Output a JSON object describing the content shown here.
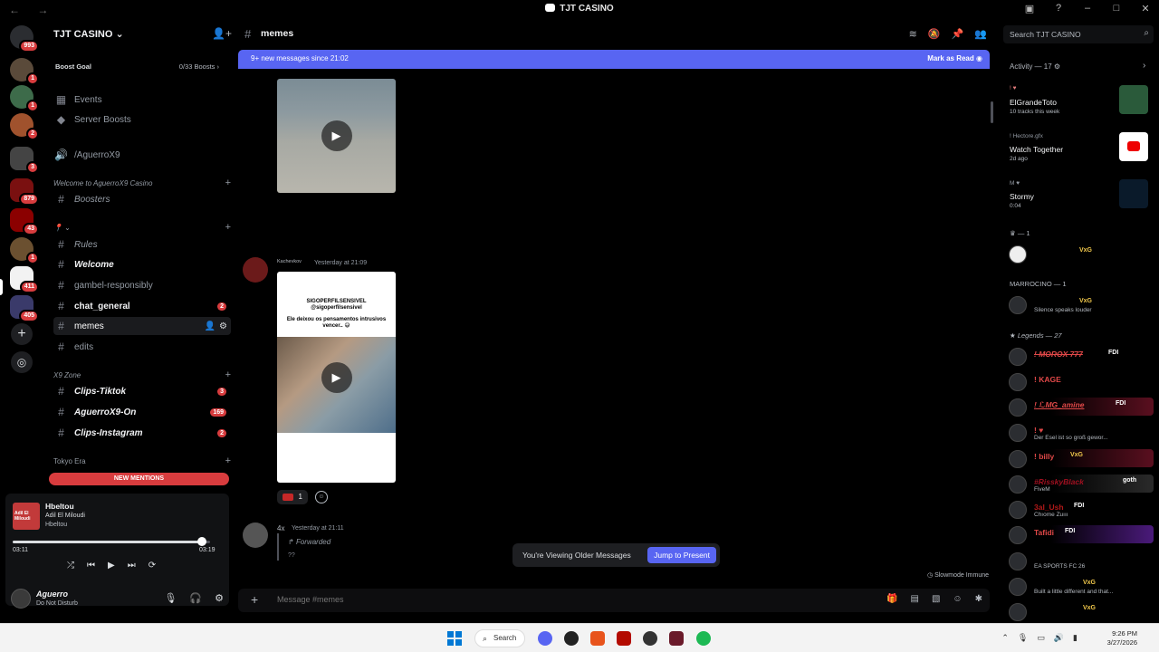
{
  "window": {
    "title": "TJT CASINO",
    "nav_arrows": "← →",
    "controls": [
      "▣",
      "?",
      "–",
      "□",
      "✕"
    ]
  },
  "server_rail": {
    "badges": [
      "993",
      "1",
      "1",
      "2",
      "3",
      "879",
      "43",
      "1",
      "411",
      "405"
    ],
    "add_label": "+",
    "discover_label": "◎"
  },
  "sidebar": {
    "server_name": "TJT CASINO",
    "boost_goal_label": "Boost Goal",
    "boost_count": "0/33 Boosts",
    "items": [
      {
        "label": "Events",
        "icon": "calendar-icon"
      },
      {
        "label": "Server Boosts",
        "icon": "boost-icon"
      },
      {
        "label": "/AguerroX9",
        "icon": "speaker-icon"
      }
    ],
    "categories": [
      {
        "label": "Welcome to AguerroX9 Casino"
      },
      {
        "label": "X9 Zone"
      },
      {
        "label": "Tokyo Era"
      }
    ],
    "channels": [
      {
        "label": "Boosters",
        "badge": ""
      },
      {
        "label": "Rules",
        "badge": ""
      },
      {
        "label": "Welcome",
        "badge": ""
      },
      {
        "label": "gambel-responsibly",
        "badge": ""
      },
      {
        "label": "chat_general",
        "badge": "2"
      },
      {
        "label": "memes",
        "badge": ""
      },
      {
        "label": "edits",
        "badge": ""
      },
      {
        "label": "Clips-Tiktok",
        "badge": "3"
      },
      {
        "label": "AguerroX9-On",
        "badge": "169"
      },
      {
        "label": "Clips-Instagram",
        "badge": "2"
      }
    ],
    "new_mentions": "NEW MENTIONS"
  },
  "player": {
    "album_text": "Adil El Miloudi",
    "track": "Hbeltou",
    "artist": "Adil El Miloudi",
    "album": "Hbeltou",
    "time_now": "03:11",
    "time_total": "03:19",
    "progress": 0.96
  },
  "user": {
    "name": "Aguerro",
    "status": "Do Not Disturb"
  },
  "chat": {
    "channel_name": "memes",
    "new_messages": "9+ new messages since 21:02",
    "mark_as_read": "Mark as Read",
    "msg2_author": "Kachevkov",
    "msg2_time": "Yesterday at 21:09",
    "video2_handle": "SIGOPERFILSENSIVEL",
    "video2_sub": "@sigoperfilsensivel",
    "video2_caption": "Ele deixou os pensamentos intrusivos vencer.. 😅",
    "reaction_count": "1",
    "msg3_author": "4x",
    "msg3_time": "Yesterday at 21:11",
    "forwarded": "Forwarded",
    "forwarded_text": "??",
    "older_notice": "You're Viewing Older Messages",
    "jump_label": "Jump to Present",
    "slowmode": "Slowmode Immune",
    "composer_placeholder": "Message #memes"
  },
  "members": {
    "search_placeholder": "Search TJT CASINO",
    "activity_title": "Activity — 17",
    "activities": [
      {
        "user": "! ♥",
        "name": "ElGrandeToto",
        "detail": "10 tracks this week"
      },
      {
        "user": "! Hectore.gfx",
        "name": "Watch Together",
        "detail": "2d ago"
      },
      {
        "user": "M ♥",
        "name": "Stormy",
        "detail": "0:04"
      }
    ],
    "group1": "— 1",
    "group1_member": "VxG",
    "group2": "MARROCINO — 1",
    "group2_sub": "Silence speaks louder",
    "group2_tag": "VxG",
    "group3": "Legends — 27",
    "legends": [
      {
        "name": "! MOROX 777",
        "tag": "FDI",
        "sub": ""
      },
      {
        "name": "! KAGE",
        "tag": "",
        "sub": ""
      },
      {
        "name": "! ℒMG_amine",
        "tag": "FDI",
        "sub": ""
      },
      {
        "name": "! ♥",
        "tag": "",
        "sub": "Der Esel ist so groß gewor..."
      },
      {
        "name": "! billy",
        "tag": "VxG",
        "sub": ""
      },
      {
        "name": "#RisskyBlack",
        "tag": "goth",
        "sub": "FiveM"
      },
      {
        "name": "3al_Ush",
        "tag": "FDI",
        "sub": "Chıome Zuııı"
      },
      {
        "name": "Tafidi",
        "tag": "FDI",
        "sub": ""
      },
      {
        "name": "",
        "tag": "",
        "sub": "EA SPORTS FC 26"
      },
      {
        "name": "",
        "tag": "VxG",
        "sub": "Built a little different and that..."
      },
      {
        "name": "",
        "tag": "VxG",
        "sub": ""
      }
    ]
  },
  "taskbar": {
    "search_label": "Search",
    "time": "9:26 PM",
    "date": "3/27/2026"
  }
}
